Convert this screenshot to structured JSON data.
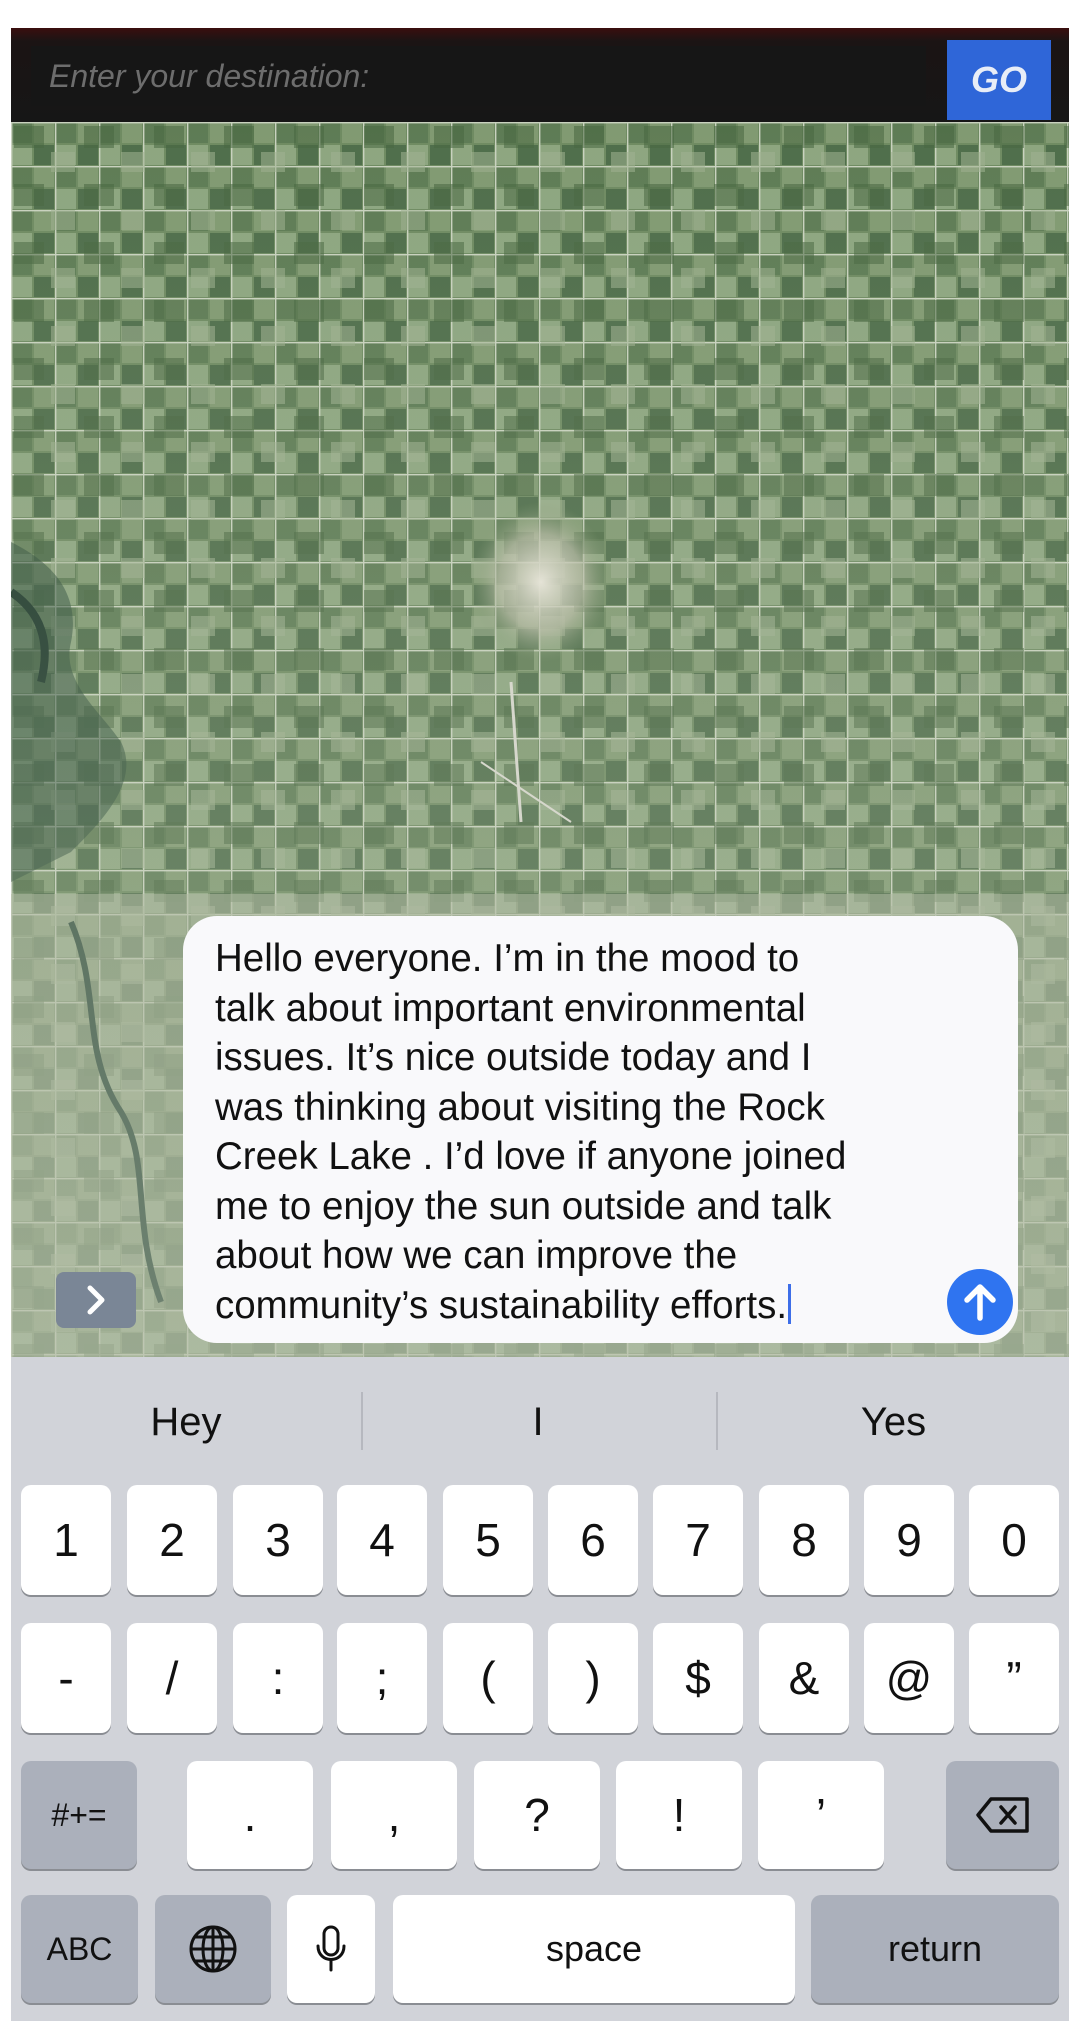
{
  "destination": {
    "placeholder": "Enter your destination:",
    "go_label": "GO"
  },
  "message": {
    "text": "Hello everyone. I’m in the mood to\ntalk about important environmental\nissues. It’s nice outside today and I\nwas thinking about visiting the Rock\nCreek Lake . I’d love if anyone joined\nme to enjoy the sun outside and talk\nabout how we can improve the\ncommunity’s sustainability efforts."
  },
  "keyboard": {
    "predictions": [
      "Hey",
      "I",
      "Yes"
    ],
    "row1": [
      "1",
      "2",
      "3",
      "4",
      "5",
      "6",
      "7",
      "8",
      "9",
      "0"
    ],
    "row2": [
      "-",
      "/",
      ":",
      ";",
      "(",
      ")",
      "$",
      "&",
      "@",
      "”"
    ],
    "row3_mode": "#+=",
    "row3": [
      ".",
      ",",
      "?",
      "!",
      "’"
    ],
    "abc": "ABC",
    "space": "space",
    "return": "return"
  },
  "icons": {
    "expand": "chevron-right-icon",
    "send": "arrow-up-icon",
    "globe": "globe-icon",
    "mic": "microphone-icon",
    "delete": "backspace-icon"
  },
  "colors": {
    "go_button": "#2f66d8",
    "send_button": "#2f74f0",
    "keyboard_bg": "#d1d3d9"
  }
}
